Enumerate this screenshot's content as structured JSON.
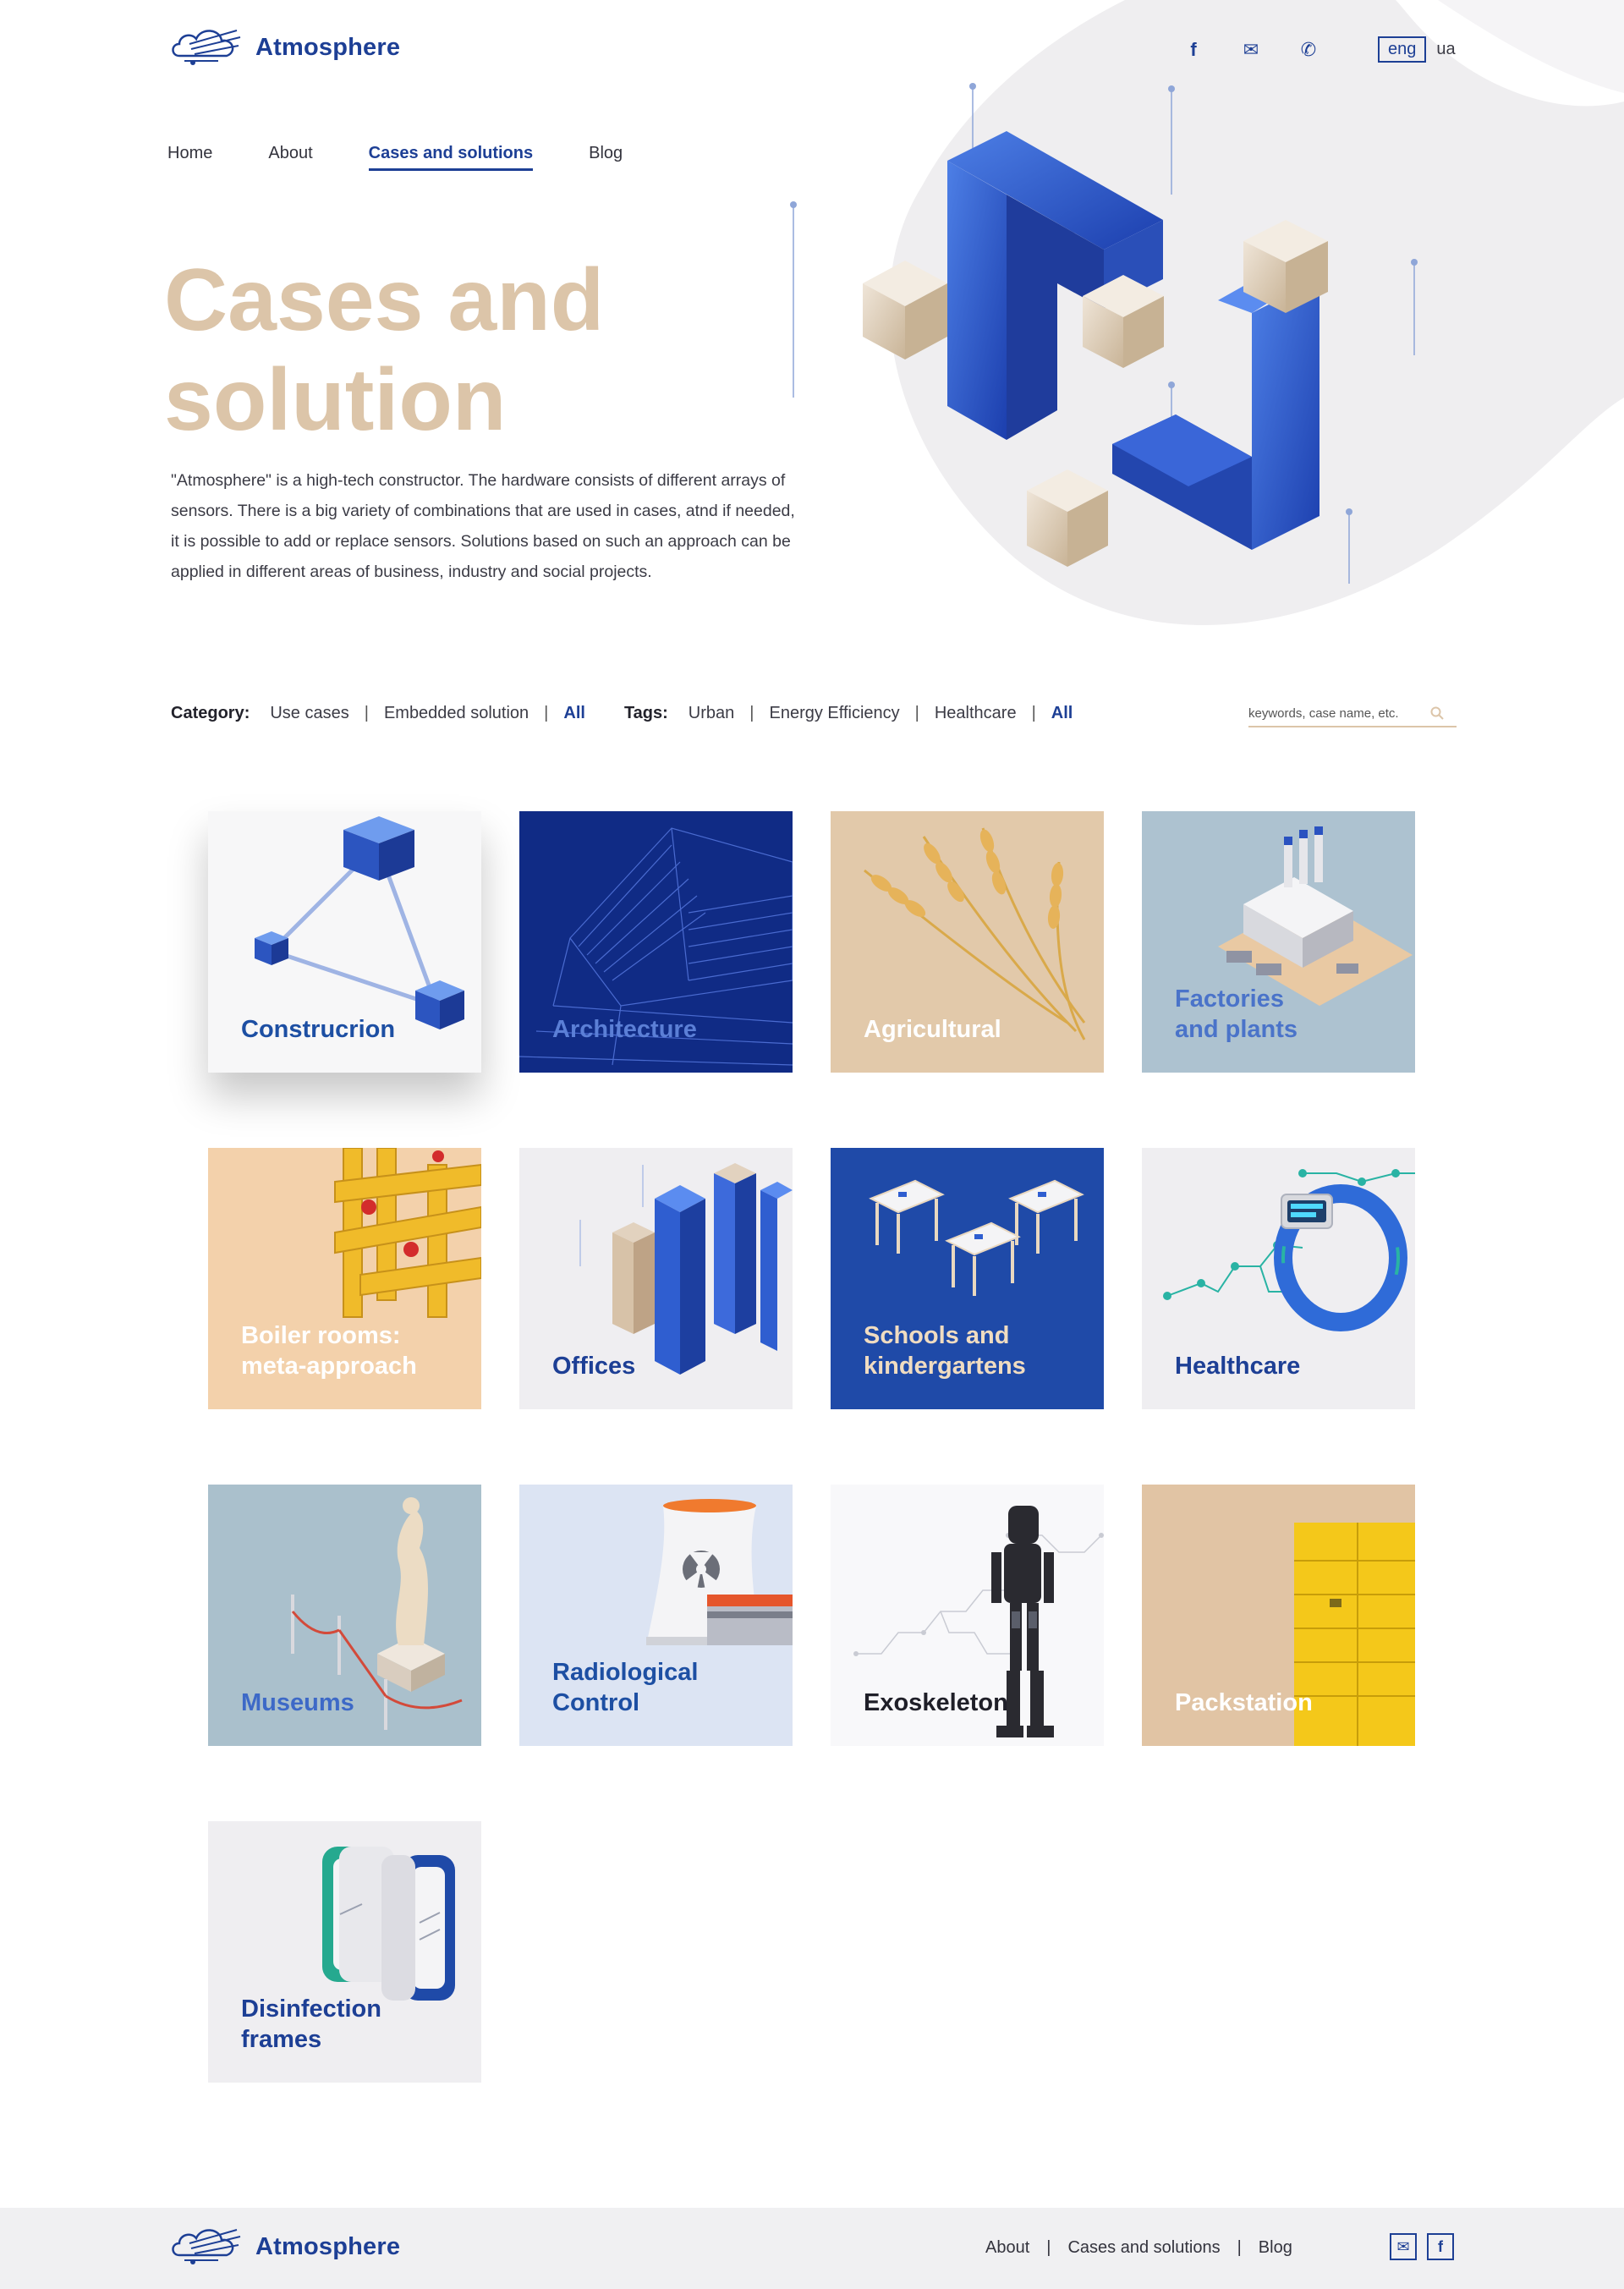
{
  "brand": {
    "name": "Atmosphere",
    "accent": "#1d3f95",
    "beige": "#dcc5a9"
  },
  "header": {
    "socials": [
      "f",
      "✉",
      "✆"
    ],
    "lang": {
      "active": "eng",
      "other": "ua"
    }
  },
  "nav": {
    "items": [
      "Home",
      "About",
      "Cases and solutions",
      "Blog"
    ],
    "current": "Cases and solutions"
  },
  "hero": {
    "title_line1": "Cases and",
    "title_line2": "solution",
    "text": "\"Atmosphere\" is a high-tech constructor. The hardware consists of different arrays of sensors. There is a big variety of combinations that are used in cases, atnd if needed, it is possible to add or replace sensors. Solutions based on such an approach can be applied in different areas of business, industry and social projects."
  },
  "filters": {
    "category_label": "Category:",
    "categories": [
      "Use cases",
      "Embedded solution",
      "All"
    ],
    "tags_label": "Tags:",
    "tags": [
      "Urban",
      "Energy Efficiency",
      "Healthcare",
      "All"
    ],
    "search_placeholder": "keywords, case name, etc."
  },
  "cards": [
    {
      "line1": "Construcrion",
      "line2": ""
    },
    {
      "line1": "Architecture",
      "line2": ""
    },
    {
      "line1": "Agricultural",
      "line2": ""
    },
    {
      "line1": "Factories",
      "line2": "and plants"
    },
    {
      "line1": "Boiler rooms:",
      "line2": "meta-approach"
    },
    {
      "line1": "Offices",
      "line2": ""
    },
    {
      "line1": "Schools and",
      "line2": "kindergartens"
    },
    {
      "line1": "Healthcare",
      "line2": ""
    },
    {
      "line1": "Museums",
      "line2": ""
    },
    {
      "line1": "Radiological",
      "line2": "Control"
    },
    {
      "line1": "Exoskeleton",
      "line2": ""
    },
    {
      "line1": "Packstation",
      "line2": ""
    },
    {
      "line1": "Disinfection",
      "line2": "frames"
    }
  ],
  "footer": {
    "links": [
      "About",
      "Cases and solutions",
      "Blog"
    ],
    "icons": [
      "✉",
      "f"
    ]
  }
}
